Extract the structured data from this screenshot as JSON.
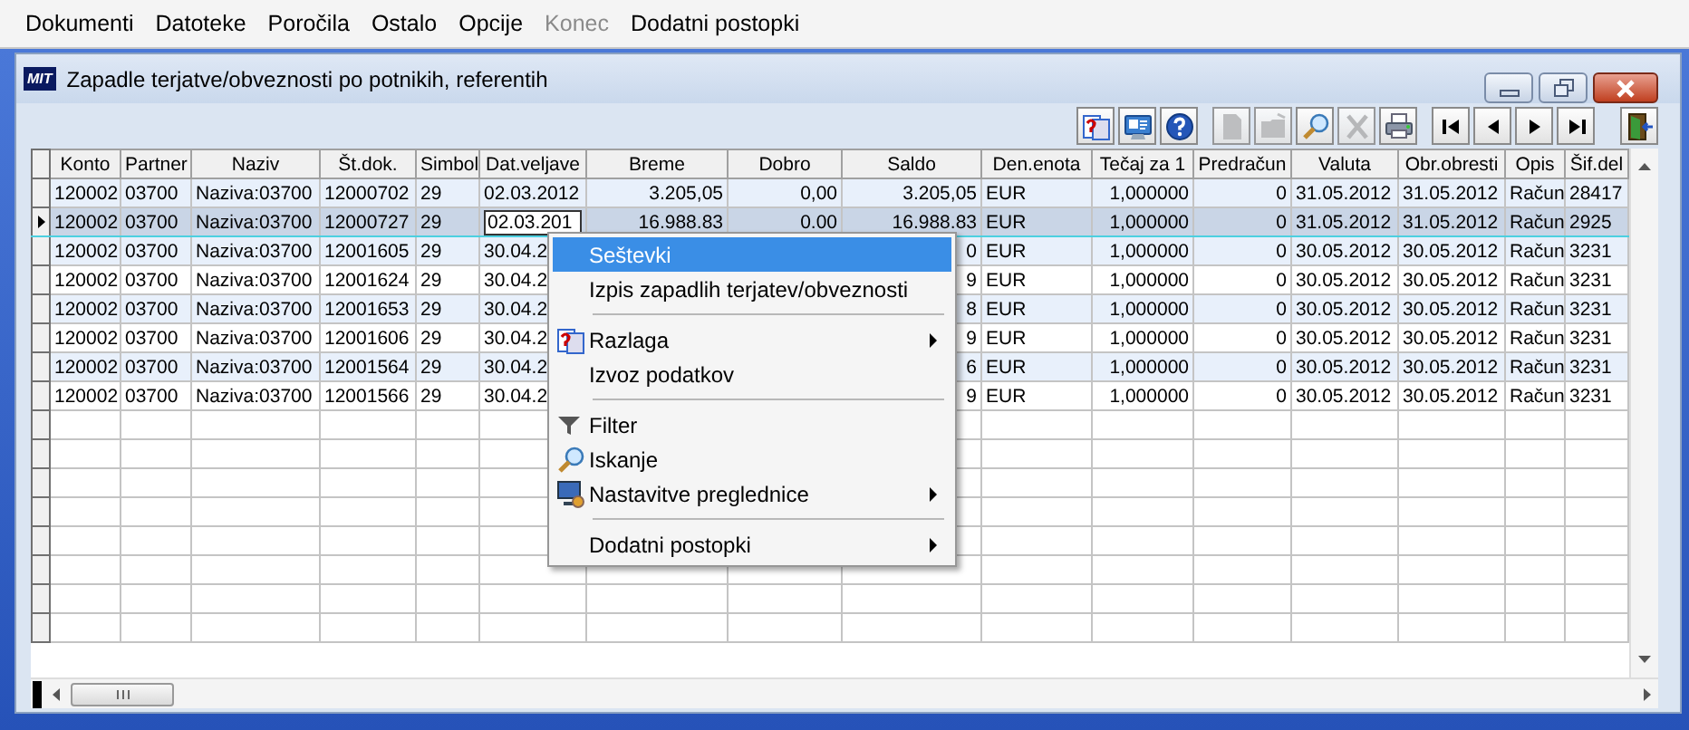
{
  "menubar": [
    {
      "label": "Dokumenti",
      "disabled": false
    },
    {
      "label": "Datoteke",
      "disabled": false
    },
    {
      "label": "Poročila",
      "disabled": false
    },
    {
      "label": "Ostalo",
      "disabled": false
    },
    {
      "label": "Opcije",
      "disabled": false
    },
    {
      "label": "Konec",
      "disabled": true
    },
    {
      "label": "Dodatni postopki",
      "disabled": false
    }
  ],
  "window": {
    "title": "Zapadle terjatve/obveznosti po potnikih, referentih",
    "logo": "MIT"
  },
  "toolbar": [
    [
      {
        "kind": "help-window",
        "disabled": false
      },
      {
        "kind": "card",
        "disabled": false
      },
      {
        "kind": "help",
        "disabled": false
      }
    ],
    [
      {
        "kind": "new",
        "disabled": true
      },
      {
        "kind": "open",
        "disabled": true
      },
      {
        "kind": "search",
        "disabled": false
      },
      {
        "kind": "delete",
        "disabled": true
      },
      {
        "kind": "print",
        "disabled": false
      }
    ],
    [
      {
        "kind": "first",
        "disabled": false
      },
      {
        "kind": "prev",
        "disabled": false
      },
      {
        "kind": "next",
        "disabled": false
      },
      {
        "kind": "last",
        "disabled": false
      }
    ],
    [
      {
        "kind": "exit",
        "disabled": false
      }
    ]
  ],
  "table": {
    "columns": [
      "Konto",
      "Partner",
      "Naziv",
      "Št.dok.",
      "Simbol",
      "Dat.veljave",
      "Breme",
      "Dobro",
      "Saldo",
      "Den.enota",
      "Tečaj za 1",
      "Predračun",
      "Valuta",
      "Obr.obresti",
      "Opis",
      "Šif.del"
    ],
    "rows": [
      {
        "selected": false,
        "cells": [
          "120002",
          "03700",
          "Naziva:03700",
          "12000702",
          "29",
          "02.03.2012",
          "3.205,05",
          "0,00",
          "3.205,05",
          "EUR",
          "1,000000",
          "0",
          "31.05.2012",
          "31.05.2012",
          "Račun",
          "28417"
        ]
      },
      {
        "selected": true,
        "cells": [
          "120002",
          "03700",
          "Naziva:03700",
          "12000727",
          "29",
          {
            "kind": "editor",
            "text": "02.03.201"
          },
          "16.988.83",
          "0.00",
          "16.988.83",
          "EUR",
          "1,000000",
          "0",
          "31.05.2012",
          "31.05.2012",
          "Račun",
          "2925"
        ]
      },
      {
        "selected": false,
        "cells": [
          "120002",
          "03700",
          "Naziva:03700",
          "12001605",
          "29",
          "30.04.2",
          null,
          null,
          "0",
          "EUR",
          "1,000000",
          "0",
          "30.05.2012",
          "30.05.2012",
          "Račun",
          "3231"
        ]
      },
      {
        "selected": false,
        "cells": [
          "120002",
          "03700",
          "Naziva:03700",
          "12001624",
          "29",
          "30.04.2",
          null,
          null,
          "9",
          "EUR",
          "1,000000",
          "0",
          "30.05.2012",
          "30.05.2012",
          "Račun",
          "3231"
        ]
      },
      {
        "selected": false,
        "cells": [
          "120002",
          "03700",
          "Naziva:03700",
          "12001653",
          "29",
          "30.04.2",
          null,
          null,
          "8",
          "EUR",
          "1,000000",
          "0",
          "30.05.2012",
          "30.05.2012",
          "Račun",
          "3231"
        ]
      },
      {
        "selected": false,
        "cells": [
          "120002",
          "03700",
          "Naziva:03700",
          "12001606",
          "29",
          "30.04.2",
          null,
          null,
          "9",
          "EUR",
          "1,000000",
          "0",
          "30.05.2012",
          "30.05.2012",
          "Račun",
          "3231"
        ]
      },
      {
        "selected": false,
        "cells": [
          "120002",
          "03700",
          "Naziva:03700",
          "12001564",
          "29",
          "30.04.2",
          null,
          null,
          "6",
          "EUR",
          "1,000000",
          "0",
          "30.05.2012",
          "30.05.2012",
          "Račun",
          "3231"
        ]
      },
      {
        "selected": false,
        "cells": [
          "120002",
          "03700",
          "Naziva:03700",
          "12001566",
          "29",
          "30.04.2",
          null,
          null,
          "9",
          "EUR",
          "1,000000",
          "0",
          "30.05.2012",
          "30.05.2012",
          "Račun",
          "3231"
        ]
      }
    ]
  },
  "context_menu": [
    {
      "kind": "plain",
      "label": "Seštevki",
      "selected": true,
      "submenu": false
    },
    {
      "kind": "plain",
      "label": "Izpis zapadlih terjatev/obveznosti",
      "selected": false,
      "submenu": false
    },
    {
      "kind": "separator"
    },
    {
      "kind": "help-window",
      "label": "Razlaga",
      "selected": false,
      "submenu": true
    },
    {
      "kind": "plain",
      "label": "Izvoz podatkov",
      "selected": false,
      "submenu": false
    },
    {
      "kind": "separator"
    },
    {
      "kind": "filter",
      "label": "Filter",
      "selected": false,
      "submenu": false
    },
    {
      "kind": "search",
      "label": "Iskanje",
      "selected": false,
      "submenu": false
    },
    {
      "kind": "settings",
      "label": "Nastavitve preglednice",
      "selected": false,
      "submenu": true
    },
    {
      "kind": "separator"
    },
    {
      "kind": "plain",
      "label": "Dodatni postopki",
      "selected": false,
      "submenu": true
    }
  ]
}
